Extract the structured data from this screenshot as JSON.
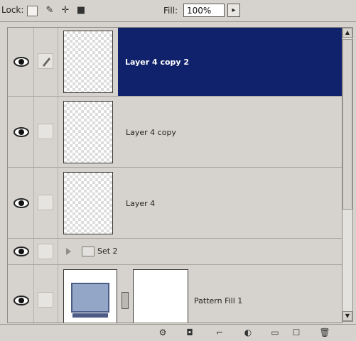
{
  "toolbar": {
    "lock_label": "Lock:",
    "fill_label": "Fill:",
    "fill_value": "100%",
    "fill_dropdown_icon": "chevron-right-icon",
    "lock_icons": [
      "transparent-lock-icon",
      "brush-lock-icon",
      "move-lock-icon",
      "padlock-icon"
    ]
  },
  "layers": [
    {
      "name": "Layer 4 copy 2",
      "selected": true,
      "visible": true,
      "linked_brush": true
    },
    {
      "name": "Layer 4 copy",
      "selected": false,
      "visible": true
    },
    {
      "name": "Layer 4",
      "selected": false,
      "visible": true
    },
    {
      "name": "Set 2",
      "type": "group",
      "visible": true
    },
    {
      "name": "Pattern Fill 1",
      "type": "fill",
      "visible": true
    }
  ],
  "colors": {
    "panel_bg": "#d6d3ce",
    "selected_bg": "#10226b",
    "selected_text": "#ffffff"
  },
  "bottom_icons": [
    "link-icon",
    "fx-icon",
    "mask-icon",
    "adjustment-icon",
    "folder-icon",
    "new-layer-icon",
    "trash-icon"
  ]
}
